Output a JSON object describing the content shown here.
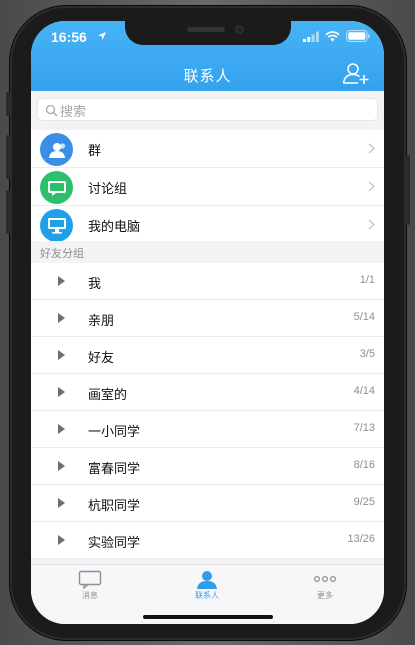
{
  "status_bar": {
    "time": "16:56"
  },
  "header": {
    "title": "联系人",
    "add_icon": "add-friend-icon"
  },
  "search": {
    "placeholder": "搜索"
  },
  "top_items": [
    {
      "label": "群",
      "icon": "group-icon",
      "color": "#3a8ee6"
    },
    {
      "label": "讨论组",
      "icon": "discussion-icon",
      "color": "#2dbf6b"
    },
    {
      "label": "我的电脑",
      "icon": "computer-icon",
      "color": "#1fa0e8"
    }
  ],
  "friend_groups": {
    "heading": "好友分组",
    "items": [
      {
        "name": "我",
        "count": "1/1"
      },
      {
        "name": "亲朋",
        "count": "5/14"
      },
      {
        "name": "好友",
        "count": "3/5"
      },
      {
        "name": "画室的",
        "count": "4/14"
      },
      {
        "name": "一小同学",
        "count": "7/13"
      },
      {
        "name": "富春同学",
        "count": "8/16"
      },
      {
        "name": "杭职同学",
        "count": "9/25"
      },
      {
        "name": "实验同学",
        "count": "13/26"
      }
    ]
  },
  "tabbar": {
    "tabs": [
      {
        "label": "消息",
        "icon": "message-icon",
        "active": false
      },
      {
        "label": "联系人",
        "icon": "contacts-icon",
        "active": true
      },
      {
        "label": "更多",
        "icon": "more-icon",
        "active": false
      }
    ]
  },
  "colors": {
    "header": "#2f9cec",
    "accent": "#2f9cec"
  }
}
